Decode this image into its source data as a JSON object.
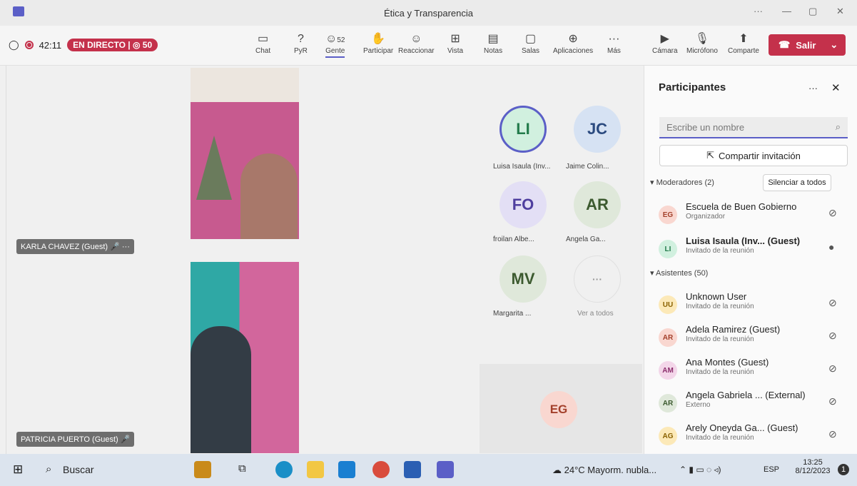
{
  "window": {
    "title": "Ética y Transparencia",
    "more": "···",
    "min": "—",
    "max": "▢",
    "close": "✕"
  },
  "toolbar": {
    "timer": "42:11",
    "live": "EN DIRECTO",
    "viewers": "50",
    "people_count": "52",
    "buttons": [
      {
        "label": "Chat",
        "icon": "chat"
      },
      {
        "label": "PyR",
        "icon": "qa"
      },
      {
        "label": "Gente",
        "icon": "people"
      },
      {
        "label": "Participar",
        "icon": "raise-hand"
      },
      {
        "label": "Reaccionar",
        "icon": "smile"
      },
      {
        "label": "Vista",
        "icon": "grid"
      },
      {
        "label": "Notas",
        "icon": "notes"
      },
      {
        "label": "Salas",
        "icon": "rooms"
      },
      {
        "label": "Aplicaciones",
        "icon": "apps"
      },
      {
        "label": "Más",
        "icon": "more"
      }
    ],
    "media": [
      {
        "label": "Cámara"
      },
      {
        "label": "Micrófono"
      },
      {
        "label": "Comparte"
      }
    ],
    "leave": "Salir"
  },
  "stage": {
    "tag1": "KARLA CHAVEZ (Guest)",
    "tag2": "PATRICIA PUERTO (Guest)",
    "avatars": [
      {
        "initials": "LI",
        "label": "Luisa Isaula (Inv..."
      },
      {
        "initials": "JC",
        "label": "Jaime Colin..."
      },
      {
        "initials": "FO",
        "label": "froilan Albe..."
      },
      {
        "initials": "AR",
        "label": "Angela Ga..."
      },
      {
        "initials": "MV",
        "label": "Margarita ..."
      },
      {
        "initials": "···",
        "label": "Ver a todos"
      }
    ],
    "eg": "EG"
  },
  "panel": {
    "title": "Participantes",
    "search_placeholder": "Escribe un nombre",
    "share": "Compartir invitación",
    "moderators": "Moderadores (2)",
    "mute_all": "Silenciar a todos",
    "attendees": "Asistentes (50)",
    "mods": [
      {
        "initials": "EG",
        "name": "Escuela de Buen Gobierno",
        "role": "Organizador"
      },
      {
        "initials": "LI",
        "name": "Luisa Isaula (Inv... (Guest)",
        "role": "Invitado de la reunión"
      }
    ],
    "atts": [
      {
        "initials": "UU",
        "name": "Unknown User",
        "role": "Invitado de la reunión"
      },
      {
        "initials": "AR",
        "name": "Adela Ramirez (Guest)",
        "role": "Invitado de la reunión"
      },
      {
        "initials": "AM",
        "name": "Ana Montes (Guest)",
        "role": "Invitado de la reunión"
      },
      {
        "initials": "AR",
        "name": "Angela Gabriela ... (External)",
        "role": "Externo"
      },
      {
        "initials": "AG",
        "name": "Arely Oneyda Ga... (Guest)",
        "role": "Invitado de la reunión"
      }
    ]
  },
  "taskbar": {
    "search": "Buscar",
    "weather": "24°C Mayorm. nubla...",
    "lang": "ESP",
    "time": "13:25",
    "date": "8/12/2023",
    "notif": "1"
  }
}
